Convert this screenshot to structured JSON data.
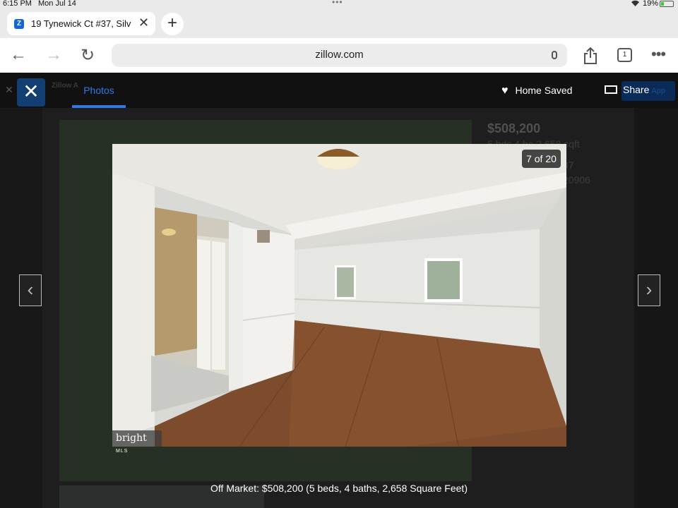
{
  "status_bar": {
    "time": "6:15 PM",
    "date": "Mon Jul 14",
    "battery": "19%"
  },
  "browser": {
    "tab_title": "19 Tynewick Ct #37, Silv",
    "favicon": "Z",
    "url": "zillow.com",
    "tab_count": "1"
  },
  "background_page": {
    "app_name": "Zillow A",
    "app_button": "App",
    "price": "$508,200",
    "details_line": "5 bds  4 ba  2,658 sqft",
    "address_line": "37",
    "zip_line": "20906"
  },
  "viewer": {
    "active_tab": "Photos",
    "home_saved_label": "Home Saved",
    "share_label": "Share",
    "counter": "7 of 20",
    "watermark_brand": "bright",
    "watermark_sub": "MLS",
    "caption": "Off Market: $508,200 (5 beds, 4 baths, 2,658 Square Feet)"
  },
  "icons": {
    "close": "close-icon",
    "heart": "heart-icon",
    "share": "mail-icon",
    "prev": "chevron-left-icon",
    "next": "chevron-right-icon"
  }
}
